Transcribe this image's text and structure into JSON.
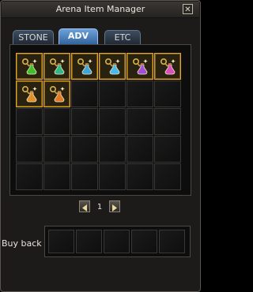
{
  "window": {
    "title": "Arena Item Manager",
    "close_glyph": "✕"
  },
  "tabs": [
    {
      "label": "STONE",
      "active": false
    },
    {
      "label": "ADV",
      "active": true
    },
    {
      "label": "ETC",
      "active": false
    }
  ],
  "inventory": {
    "rows": 5,
    "columns": 6,
    "items": [
      {
        "icon": "green-potion-icon",
        "liquid_color": "#3fbf2f"
      },
      {
        "icon": "teal-potion-icon",
        "liquid_color": "#2fb88a"
      },
      {
        "icon": "cyan-potion-icon",
        "liquid_color": "#3fa6d8"
      },
      {
        "icon": "sky-potion-icon",
        "liquid_color": "#4ab8e8"
      },
      {
        "icon": "purple-potion-icon",
        "liquid_color": "#a24fd8"
      },
      {
        "icon": "magenta-potion-icon",
        "liquid_color": "#d84fbf"
      },
      {
        "icon": "orange-potion-icon",
        "liquid_color": "#e0902a"
      },
      {
        "icon": "amber-potion-icon",
        "liquid_color": "#e07a2a"
      }
    ]
  },
  "pager": {
    "current_page": "1"
  },
  "buyback": {
    "label": "Buy back",
    "slots": 5
  },
  "colors": {
    "slot_border_filled": "#e0a82a",
    "active_tab": "#4a86c8"
  }
}
